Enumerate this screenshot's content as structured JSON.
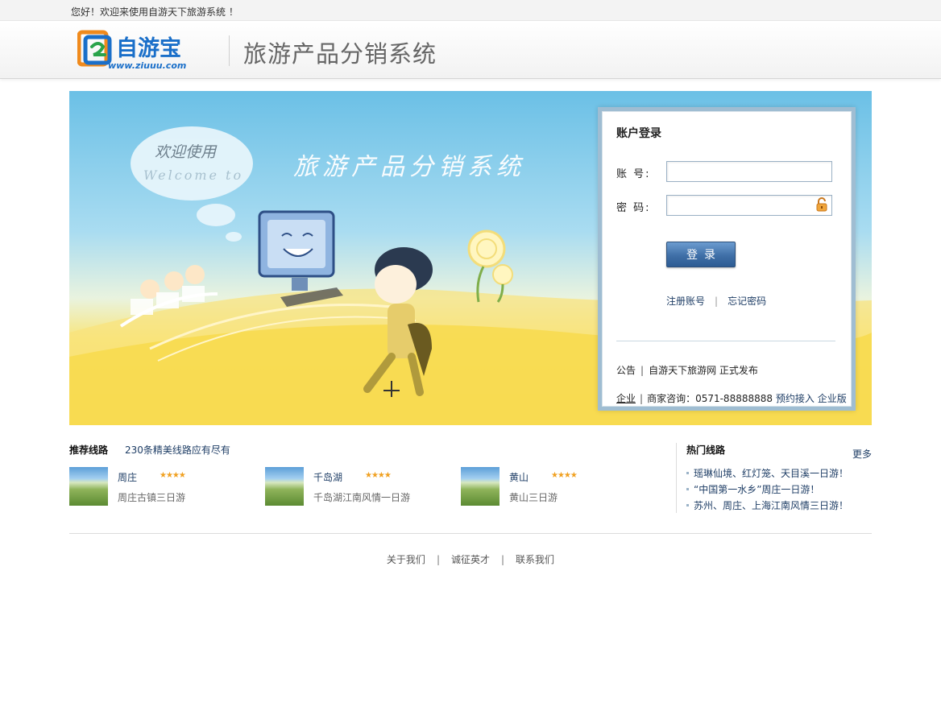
{
  "topbar": {
    "welcome": "您好！欢迎来使用自游天下旅游系统 ！"
  },
  "header": {
    "logo_text": "自游宝",
    "logo_url_text": "www.ziuuu.com",
    "title": "旅游产品分销系统"
  },
  "banner": {
    "bubble_cn": "欢迎使用",
    "bubble_en": "Welcome to",
    "headline": "旅游产品分销系统"
  },
  "login": {
    "title": "账户登录",
    "account_label": "账 号:",
    "account_value": "",
    "password_label": "密 码:",
    "password_value": "",
    "submit_label": "登录",
    "register_link": "注册账号",
    "link_separator": "|",
    "forgot_link": "忘记密码",
    "notice_label": "公告",
    "notice_separator": "|",
    "notice_text": "自游天下旅游网 正式发布",
    "enterprise_label": "企业",
    "enterprise_separator": "|",
    "merchant_consult": "商家咨询：0571-88888888",
    "booking_access": "预约接入",
    "enterprise_edition": "企业版"
  },
  "recommended": {
    "title": "推荐线路",
    "subtitle": "230条精美线路应有尽有",
    "items": [
      {
        "name": "周庄",
        "stars": "★★★★",
        "desc": "周庄古镇三日游"
      },
      {
        "name": "千岛湖",
        "stars": "★★★★",
        "desc": "千岛湖江南风情一日游"
      },
      {
        "name": "黄山",
        "stars": "★★★★",
        "desc": "黄山三日游"
      }
    ]
  },
  "hot": {
    "title": "热门线路",
    "more": "更多",
    "items": [
      "瑶琳仙境、红灯笼、天目溪一日游！",
      "“中国第一水乡”周庄一日游！",
      "苏州、周庄、上海江南风情三日游！"
    ]
  },
  "footer": {
    "about": "关于我们",
    "jobs": "诚征英才",
    "contact": "联系我们",
    "separator": "|"
  },
  "colors": {
    "link": "#1f3e66",
    "banner_sky": "#6bc0e6",
    "banner_ground": "#f7dc4b",
    "login_button": "#3f6fa7",
    "logo_blue": "#1a6fc9",
    "logo_orange": "#f08a1c"
  }
}
